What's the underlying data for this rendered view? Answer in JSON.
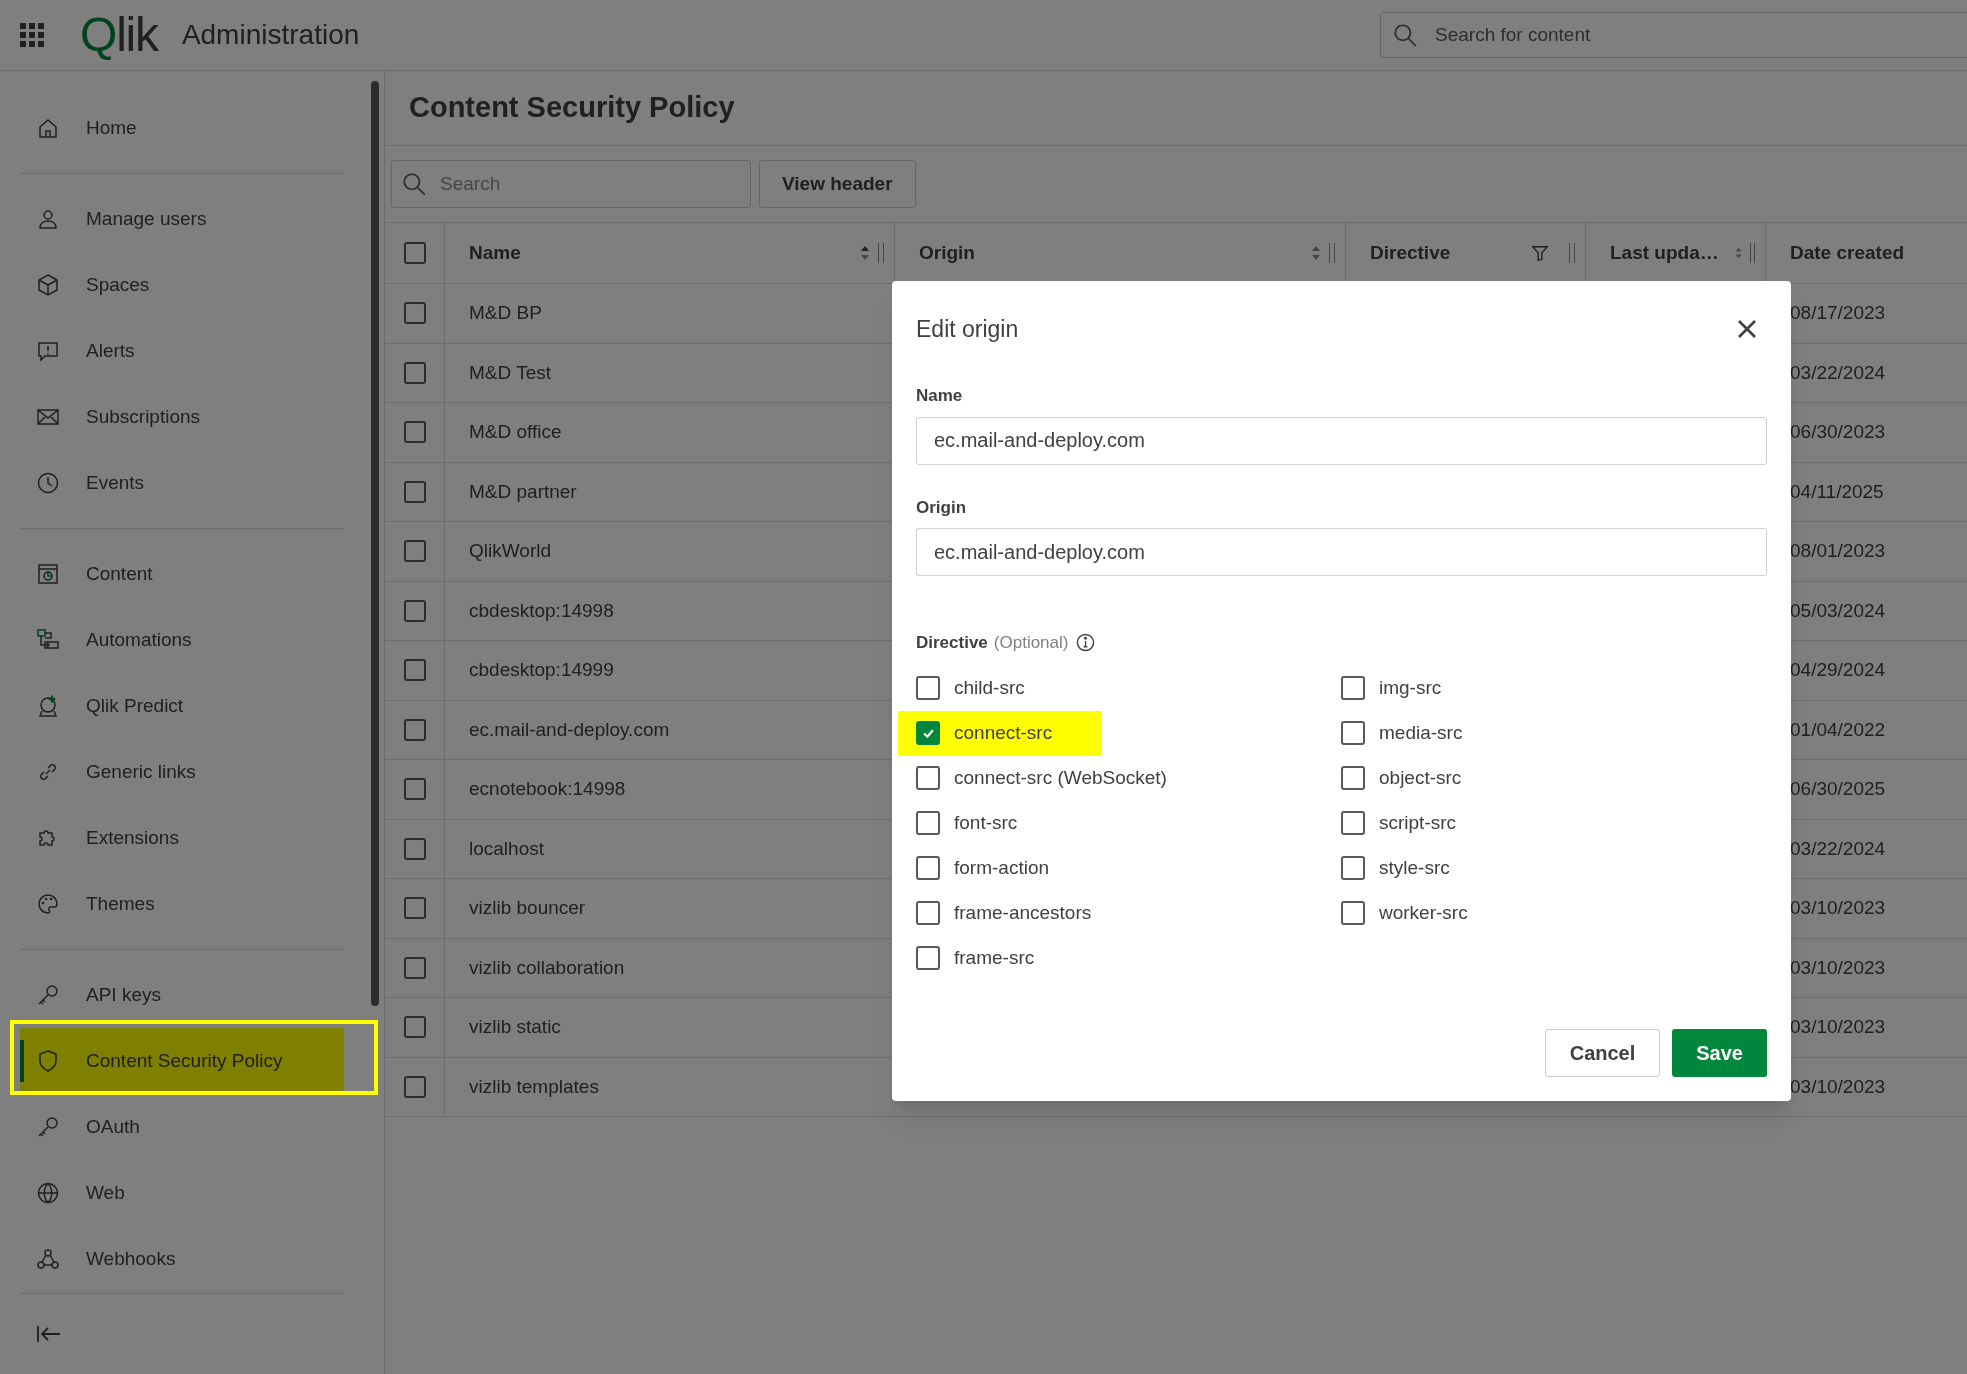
{
  "header": {
    "logo": "Qlik",
    "title": "Administration",
    "search": {
      "placeholder": "Search for content"
    }
  },
  "sidebar": {
    "groups": [
      [
        {
          "label": "Home",
          "selected": false,
          "highlighted": false
        }
      ],
      [
        {
          "label": "Manage users",
          "selected": false,
          "highlighted": false
        },
        {
          "label": "Spaces",
          "selected": false,
          "highlighted": false
        },
        {
          "label": "Alerts",
          "selected": false,
          "highlighted": false
        },
        {
          "label": "Subscriptions",
          "selected": false,
          "highlighted": false
        },
        {
          "label": "Events",
          "selected": false,
          "highlighted": false
        }
      ],
      [
        {
          "label": "Content",
          "selected": false,
          "highlighted": false
        },
        {
          "label": "Automations",
          "selected": false,
          "highlighted": false
        },
        {
          "label": "Qlik Predict",
          "selected": false,
          "highlighted": false
        },
        {
          "label": "Generic links",
          "selected": false,
          "highlighted": false
        },
        {
          "label": "Extensions",
          "selected": false,
          "highlighted": false
        },
        {
          "label": "Themes",
          "selected": false,
          "highlighted": false
        }
      ],
      [
        {
          "label": "API keys",
          "selected": false,
          "highlighted": false
        },
        {
          "label": "Content Security Policy",
          "selected": true,
          "highlighted": true
        },
        {
          "label": "OAuth",
          "selected": false,
          "highlighted": false
        },
        {
          "label": "Web",
          "selected": false,
          "highlighted": false
        },
        {
          "label": "Webhooks",
          "selected": false,
          "highlighted": false
        }
      ]
    ]
  },
  "page": {
    "title": "Content Security Policy",
    "search": {
      "placeholder": "Search"
    },
    "view_header_button": "View header"
  },
  "table": {
    "select_all_checked": false,
    "columns": [
      {
        "label": "Name",
        "kind": "sort"
      },
      {
        "label": "Origin",
        "kind": "sort"
      },
      {
        "label": "Directive",
        "kind": "filter"
      },
      {
        "label": "Last upda…",
        "kind": "sort"
      },
      {
        "label": "Date created",
        "kind": "plain"
      }
    ],
    "rows": [
      {
        "checked": false,
        "name": "M&D BP",
        "date_created": "08/17/2023"
      },
      {
        "checked": false,
        "name": "M&D Test",
        "date_created": "03/22/2024"
      },
      {
        "checked": false,
        "name": "M&D office",
        "date_created": "06/30/2023"
      },
      {
        "checked": false,
        "name": "M&D partner",
        "date_created": "04/11/2025"
      },
      {
        "checked": false,
        "name": "QlikWorld",
        "date_created": "08/01/2023"
      },
      {
        "checked": false,
        "name": "cbdesktop:14998",
        "date_created": "05/03/2024"
      },
      {
        "checked": false,
        "name": "cbdesktop:14999",
        "date_created": "04/29/2024"
      },
      {
        "checked": false,
        "name": "ec.mail-and-deploy.com",
        "date_created": "01/04/2022"
      },
      {
        "checked": false,
        "name": "ecnotebook:14998",
        "date_created": "06/30/2025"
      },
      {
        "checked": false,
        "name": "localhost",
        "date_created": "03/22/2024"
      },
      {
        "checked": false,
        "name": "vizlib bouncer",
        "date_created": "03/10/2023"
      },
      {
        "checked": false,
        "name": "vizlib collaboration",
        "date_created": "03/10/2023"
      },
      {
        "checked": false,
        "name": "vizlib static",
        "date_created": "03/10/2023"
      },
      {
        "checked": false,
        "name": "vizlib templates",
        "date_created": "03/10/2023"
      }
    ]
  },
  "dialog": {
    "title": "Edit origin",
    "name_label": "Name",
    "name_value": "ec.mail-and-deploy.com",
    "origin_label": "Origin",
    "origin_value": "ec.mail-and-deploy.com",
    "directive_label": "Directive",
    "directive_hint": "(Optional)",
    "directives_left": [
      {
        "label": "child-src",
        "checked": false,
        "highlighted": false
      },
      {
        "label": "connect-src",
        "checked": true,
        "highlighted": true
      },
      {
        "label": "connect-src (WebSocket)",
        "checked": false,
        "highlighted": false
      },
      {
        "label": "font-src",
        "checked": false,
        "highlighted": false
      },
      {
        "label": "form-action",
        "checked": false,
        "highlighted": false
      },
      {
        "label": "frame-ancestors",
        "checked": false,
        "highlighted": false
      },
      {
        "label": "frame-src",
        "checked": false,
        "highlighted": false
      }
    ],
    "directives_right": [
      {
        "label": "img-src",
        "checked": false,
        "highlighted": false
      },
      {
        "label": "media-src",
        "checked": false,
        "highlighted": false
      },
      {
        "label": "object-src",
        "checked": false,
        "highlighted": false
      },
      {
        "label": "script-src",
        "checked": false,
        "highlighted": false
      },
      {
        "label": "style-src",
        "checked": false,
        "highlighted": false
      },
      {
        "label": "worker-src",
        "checked": false,
        "highlighted": false
      }
    ],
    "buttons": [
      {
        "label": "Cancel",
        "kind": "secondary"
      },
      {
        "label": "Save",
        "kind": "primary"
      }
    ]
  }
}
